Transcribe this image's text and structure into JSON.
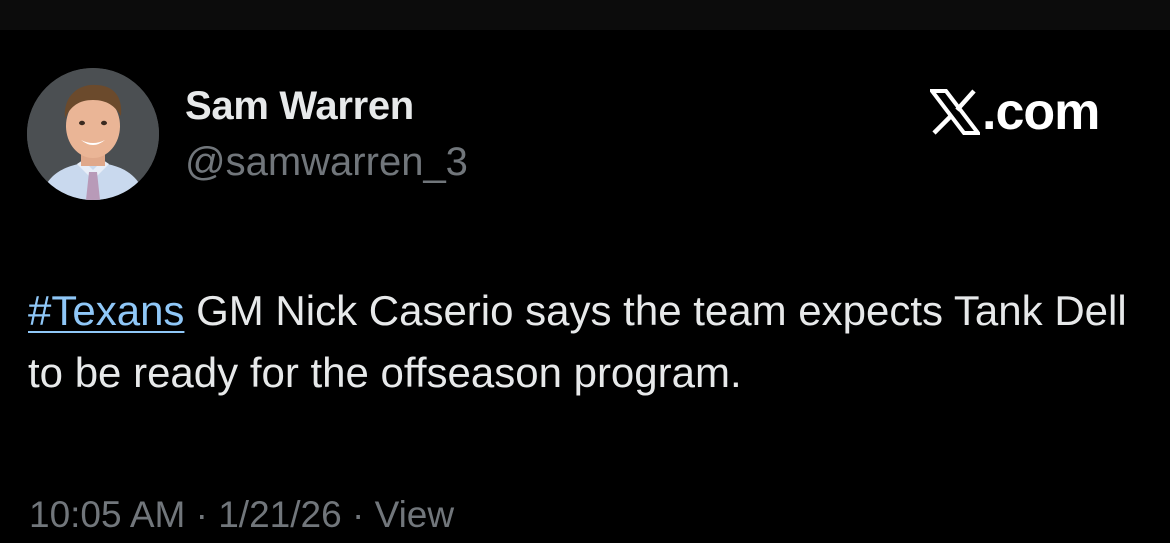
{
  "colors": {
    "background": "#000000",
    "primary_text": "#e7e9ea",
    "secondary_text": "#71767b",
    "hashtag": "#8fc7f7"
  },
  "author": {
    "display_name": "Sam Warren",
    "handle": "@samwarren_3",
    "avatar_icon": "profile-photo"
  },
  "brand": {
    "logo_icon": "x-logo-icon",
    "text": ".com"
  },
  "tweet": {
    "hashtag": "#Texans",
    "text_after_hashtag": " GM Nick Caserio says the team expects Tank Dell to be ready for the offseason program."
  },
  "meta": {
    "time": "10:05 AM",
    "separator": " · ",
    "date": "1/21/26",
    "views_label": "View"
  }
}
